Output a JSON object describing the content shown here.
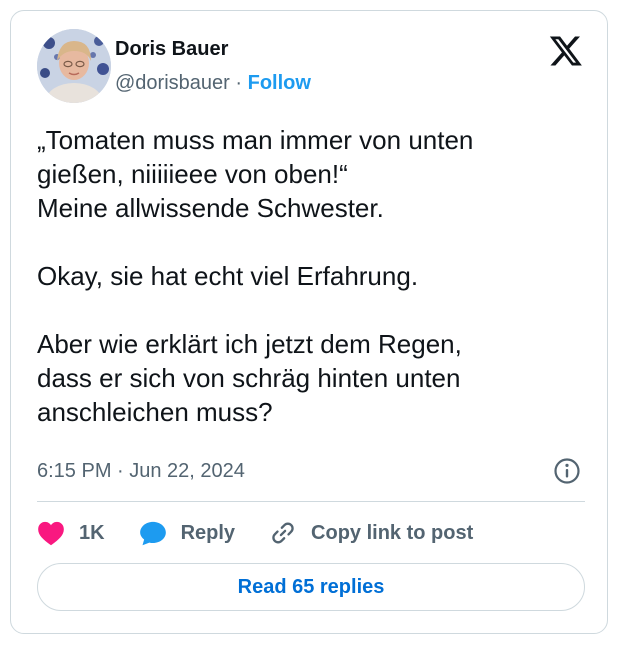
{
  "author": {
    "display_name": "Doris Bauer",
    "handle": "@dorisbauer",
    "separator": "·",
    "follow_label": "Follow"
  },
  "logo_icon": "x-logo-icon",
  "tweet": {
    "text": "„Tomaten muss man immer von unten\ngießen, niiiiieee von oben!“\nMeine allwissende Schwester.\n\nOkay, sie hat echt viel Erfahrung.\n\nAber wie erklärt ich jetzt dem Regen,\ndass er sich von schräg hinten unten\nanschleichen muss?",
    "timestamp": "6:15 PM · Jun 22, 2024"
  },
  "actions": {
    "like_count": "1K",
    "reply_label": "Reply",
    "copy_link_label": "Copy link to post"
  },
  "read_replies_label": "Read 65 replies",
  "colors": {
    "like": "#f91880",
    "reply": "#1d9bf0",
    "link": "#006fd6",
    "secondary_text": "#536471",
    "border": "#cfd9de"
  }
}
